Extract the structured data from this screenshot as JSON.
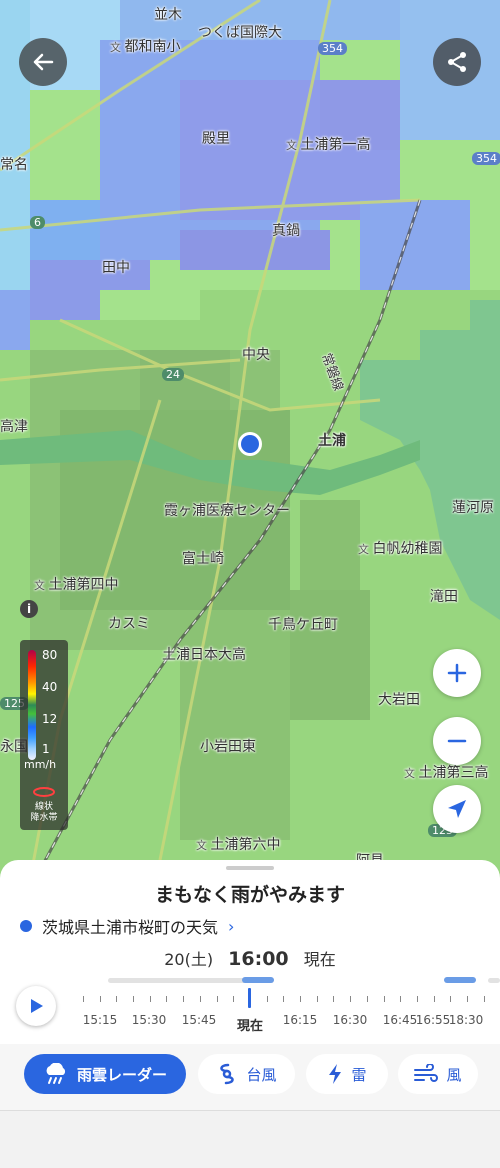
{
  "map": {
    "place_labels": [
      {
        "text": "並木",
        "school": false
      },
      {
        "text": "つくば国際大",
        "school": false
      },
      {
        "text": "都和南小",
        "school": true
      },
      {
        "text": "殿里",
        "school": false
      },
      {
        "text": "土浦第一高",
        "school": true
      },
      {
        "text": "常名",
        "school": false
      },
      {
        "text": "真鍋",
        "school": false
      },
      {
        "text": "田中",
        "school": false
      },
      {
        "text": "中央",
        "school": false
      },
      {
        "text": "常磐線",
        "school": false
      },
      {
        "text": "高津",
        "school": false
      },
      {
        "text": "土浦",
        "school": false
      },
      {
        "text": "霞ヶ浦医療センター",
        "school": false
      },
      {
        "text": "蓮河原",
        "school": false
      },
      {
        "text": "白帆幼稚園",
        "school": true
      },
      {
        "text": "富士崎",
        "school": false
      },
      {
        "text": "土浦第四中",
        "school": true
      },
      {
        "text": "滝田",
        "school": false
      },
      {
        "text": "カスミ",
        "school": false
      },
      {
        "text": "千鳥ケ丘町",
        "school": false
      },
      {
        "text": "土浦日本大高",
        "school": true
      },
      {
        "text": "大岩田",
        "school": false
      },
      {
        "text": "永国",
        "school": false
      },
      {
        "text": "小岩田東",
        "school": false
      },
      {
        "text": "土浦第三高",
        "school": true
      },
      {
        "text": "土浦第六中",
        "school": true
      },
      {
        "text": "阿見",
        "school": false
      }
    ],
    "route_shields": [
      "354",
      "354",
      "6",
      "24",
      "125",
      "125"
    ],
    "legend": {
      "values": [
        "80",
        "40",
        "12",
        "1"
      ],
      "unit": "mm/h",
      "linear_band": "線状\n降水帯"
    },
    "info_icon": "i"
  },
  "sheet": {
    "headline": "まもなく雨がやみます",
    "location": "茨城県土浦市桜町の天気",
    "date": "20(土)",
    "time": "16:00",
    "now_label": "現在",
    "timeline": [
      "15:15",
      "15:30",
      "15:45",
      "現在",
      "16:15",
      "16:30",
      "16:45",
      "16:55",
      "18:30"
    ]
  },
  "tabs": [
    {
      "label": "雨雲レーダー",
      "icon": "rain-cloud-icon"
    },
    {
      "label": "台風",
      "icon": "typhoon-icon"
    },
    {
      "label": "雷",
      "icon": "lightning-icon"
    },
    {
      "label": "風",
      "icon": "wind-icon"
    }
  ],
  "colors": {
    "accent": "#2a66e0",
    "rain_light": "#9fe08a",
    "rain_mid": "#6fa0ff",
    "rain_blue": "#8aa8ee"
  }
}
